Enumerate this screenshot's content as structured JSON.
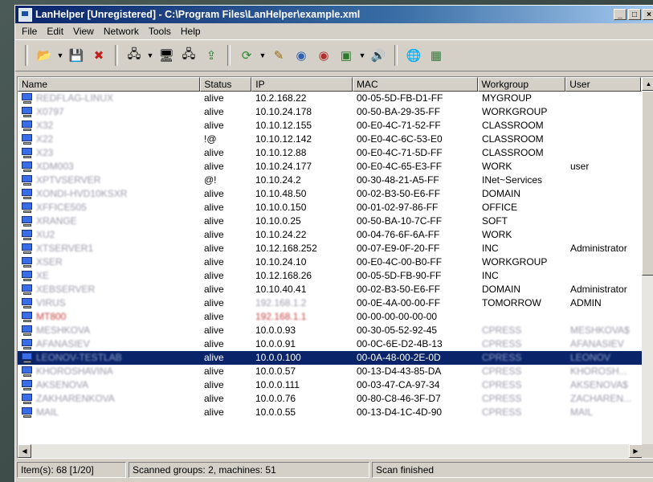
{
  "window": {
    "title": "LanHelper [Unregistered] - C:\\Program Files\\LanHelper\\example.xml"
  },
  "menu": [
    "File",
    "Edit",
    "View",
    "Network",
    "Tools",
    "Help"
  ],
  "columns": [
    "Name",
    "Status",
    "IP",
    "MAC",
    "Workgroup",
    "User"
  ],
  "rows": [
    {
      "name": "REDFLAG-LINUX",
      "status": "alive",
      "ip": "10.2.168.22",
      "mac": "00-05-5D-FB-D1-FF",
      "wg": "MYGROUP",
      "user": ""
    },
    {
      "name": "X0797",
      "status": "alive",
      "ip": "10.10.24.178",
      "mac": "00-50-BA-29-35-FF",
      "wg": "WORKGROUP",
      "user": ""
    },
    {
      "name": "X32",
      "status": "alive",
      "ip": "10.10.12.155",
      "mac": "00-E0-4C-71-52-FF",
      "wg": "CLASSROOM",
      "user": ""
    },
    {
      "name": "X22",
      "status": "!@",
      "ip": "10.10.12.142",
      "mac": "00-E0-4C-6C-53-E0",
      "wg": "CLASSROOM",
      "user": ""
    },
    {
      "name": "X23",
      "status": "alive",
      "ip": "10.10.12.88",
      "mac": "00-E0-4C-71-5D-FF",
      "wg": "CLASSROOM",
      "user": ""
    },
    {
      "name": "XDM003",
      "status": "alive",
      "ip": "10.10.24.177",
      "mac": "00-E0-4C-65-E3-FF",
      "wg": "WORK",
      "user": "user"
    },
    {
      "name": "XPTVSERVER",
      "status": "@!",
      "ip": "10.10.24.2",
      "mac": "00-30-48-21-A5-FF",
      "wg": "INet~Services",
      "user": ""
    },
    {
      "name": "XONDI-HVD10KSXR",
      "status": "alive",
      "ip": "10.10.48.50",
      "mac": "00-02-B3-50-E6-FF",
      "wg": "DOMAIN",
      "user": ""
    },
    {
      "name": "XFFICE505",
      "status": "alive",
      "ip": "10.10.0.150",
      "mac": "00-01-02-97-86-FF",
      "wg": "OFFICE",
      "user": ""
    },
    {
      "name": "XRANGE",
      "status": "alive",
      "ip": "10.10.0.25",
      "mac": "00-50-BA-10-7C-FF",
      "wg": "SOFT",
      "user": ""
    },
    {
      "name": "XU2",
      "status": "alive",
      "ip": "10.10.24.22",
      "mac": "00-04-76-6F-6A-FF",
      "wg": "WORK",
      "user": ""
    },
    {
      "name": "XTSERVER1",
      "status": "alive",
      "ip": "10.12.168.252",
      "mac": "00-07-E9-0F-20-FF",
      "wg": "INC",
      "user": "Administrator"
    },
    {
      "name": "XSER",
      "status": "alive",
      "ip": "10.10.24.10",
      "mac": "00-E0-4C-00-B0-FF",
      "wg": "WORKGROUP",
      "user": ""
    },
    {
      "name": "XE",
      "status": "alive",
      "ip": "10.12.168.26",
      "mac": "00-05-5D-FB-90-FF",
      "wg": "INC",
      "user": ""
    },
    {
      "name": "XEBSERVER",
      "status": "alive",
      "ip": "10.10.40.41",
      "mac": "00-02-B3-50-E6-FF",
      "wg": "DOMAIN",
      "user": "Administrator"
    },
    {
      "name": "VIRUS",
      "status": "alive",
      "ip": "192.168.1.2",
      "mac": "00-0E-4A-00-00-FF",
      "wg": "TOMORROW",
      "user": "ADMIN"
    },
    {
      "name": "MT800",
      "status": "alive",
      "ip": "192.168.1.1",
      "mac": "00-00-00-00-00-00",
      "wg": "",
      "user": ""
    },
    {
      "name": "MESHKOVA",
      "status": "alive",
      "ip": "10.0.0.93",
      "mac": "00-30-05-52-92-45",
      "wg": "CPRESS",
      "user": "MESHKOVA$"
    },
    {
      "name": "AFANASIEV",
      "status": "alive",
      "ip": "10.0.0.91",
      "mac": "00-0C-6E-D2-4B-13",
      "wg": "CPRESS",
      "user": "AFANASIEV"
    },
    {
      "name": "LEONOV-TESTLAB",
      "status": "alive",
      "ip": "10.0.0.100",
      "mac": "00-0A-48-00-2E-0D",
      "wg": "CPRESS",
      "user": "LEONOV"
    },
    {
      "name": "KHOROSHAVINA",
      "status": "alive",
      "ip": "10.0.0.57",
      "mac": "00-13-D4-43-85-DA",
      "wg": "CPRESS",
      "user": "KHOROSH..."
    },
    {
      "name": "AKSENOVA",
      "status": "alive",
      "ip": "10.0.0.111",
      "mac": "00-03-47-CA-97-34",
      "wg": "CPRESS",
      "user": "AKSENOVA$"
    },
    {
      "name": "ZAKHARENKOVA",
      "status": "alive",
      "ip": "10.0.0.76",
      "mac": "00-80-C8-46-3F-D7",
      "wg": "CPRESS",
      "user": "ZACHAREN..."
    },
    {
      "name": "MAIL",
      "status": "alive",
      "ip": "10.0.0.55",
      "mac": "00-13-D4-1C-4D-90",
      "wg": "CPRESS",
      "user": "MAIL"
    }
  ],
  "selected_index": 19,
  "status": {
    "items": "Item(s): 68 [1/20]",
    "scanned": "Scanned groups: 2, machines: 51",
    "state": "Scan finished"
  }
}
